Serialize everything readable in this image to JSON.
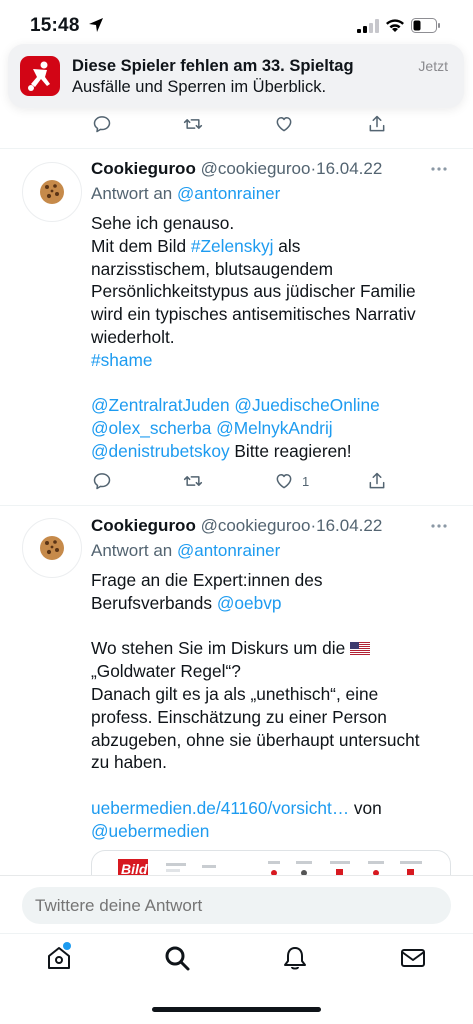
{
  "status_bar": {
    "time": "15:48"
  },
  "notification": {
    "title": "Diese Spieler fehlen am 33. Spieltag",
    "body": "Ausfälle und Sperren im Überblick.",
    "time": "Jetzt"
  },
  "tweets": [
    {
      "name": "Cookieguroo",
      "handle": "@cookieguroo",
      "separator": "·",
      "date": "16.04.22",
      "reply_prefix": "Antwort an",
      "reply_to": "@antonrainer",
      "text": {
        "l1": "Sehe ich genauso.",
        "l2a": "Mit dem Bild ",
        "l2b": "#Zelenskyj",
        "l2c": " als",
        "l3": "narzisstischem, blutsaugendem",
        "l4": "Persönlichkeitstypus aus jüdischer Familie",
        "l5": "wird ein typisches antisemitisches Narrativ",
        "l6": "wiederholt.",
        "l7": "#shame",
        "l9a": "@ZentralratJuden",
        "l9b": "@JuedischeOnline",
        "l10a": "@olex_scherba",
        "l10b": "@MelnykAndrij",
        "l11a": "@denistrubetskoy",
        "l11b": " Bitte reagieren!"
      },
      "like_count": "1"
    },
    {
      "name": "Cookieguroo",
      "handle": "@cookieguroo",
      "separator": "·",
      "date": "16.04.22",
      "reply_prefix": "Antwort an",
      "reply_to": "@antonrainer",
      "text": {
        "l1": "Frage an die Expert:innen des",
        "l2a": "Berufsverbands ",
        "l2b": "@oebvp",
        "l4": "Wo stehen Sie im Diskurs um die ",
        "l5": "„Goldwater Regel“?",
        "l6": "Danach gilt es ja als „unethisch“, eine",
        "l7": "profess. Einschätzung zu einer Person",
        "l8": "abzugeben, ohne sie überhaupt untersucht",
        "l9": "zu haben.",
        "l11a": "uebermedien.de/41160/vorsicht…",
        "l11b": " von",
        "l12": "@uebermedien"
      },
      "card_logo": "Bild"
    }
  ],
  "reply_bar": {
    "placeholder": "Twittere deine Antwort"
  },
  "icons": {
    "top_actions": [
      "reply-icon",
      "retweet-icon",
      "like-icon",
      "share-icon"
    ],
    "tabs": [
      "home-icon",
      "search-icon",
      "notifications-icon",
      "messages-icon"
    ]
  },
  "colors": {
    "accent": "#1d9bf0",
    "text": "#0f1419",
    "muted": "#536471",
    "notif_icon": "#d20515"
  }
}
